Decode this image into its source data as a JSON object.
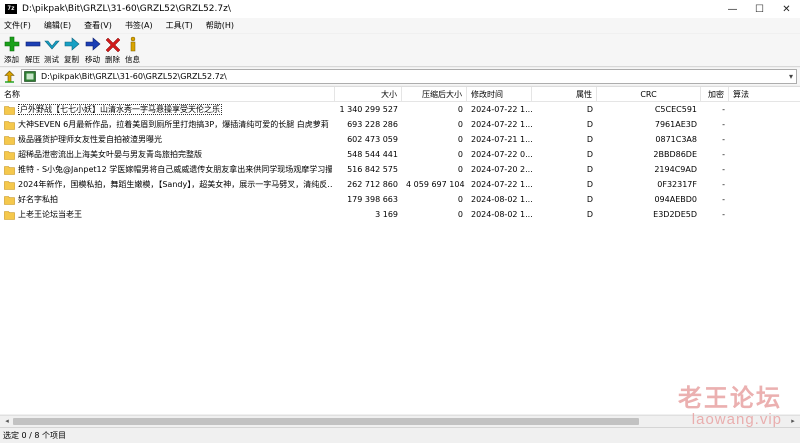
{
  "window": {
    "app_icon_text": "7z",
    "title": "D:\\pikpak\\Bit\\GRZL\\31-60\\GRZL52\\GRZL52.7z\\",
    "minimize": "—",
    "maximize": "☐",
    "close": "✕"
  },
  "menu": [
    "文件(F)",
    "编辑(E)",
    "查看(V)",
    "书签(A)",
    "工具(T)",
    "帮助(H)"
  ],
  "toolbar": [
    {
      "label": "添加",
      "icon": "add-icon",
      "color": "#1aa11a"
    },
    {
      "label": "解压",
      "icon": "extract-icon",
      "color": "#1c3fb5"
    },
    {
      "label": "测试",
      "icon": "test-icon",
      "color": "#18a0c4"
    },
    {
      "label": "复制",
      "icon": "copy-icon",
      "color": "#18a0c4"
    },
    {
      "label": "移动",
      "icon": "move-icon",
      "color": "#1c3fb5"
    },
    {
      "label": "删除",
      "icon": "delete-icon",
      "color": "#d01a1a"
    },
    {
      "label": "信息",
      "icon": "info-icon",
      "color": "#d9a400"
    }
  ],
  "address": {
    "path": "D:\\pikpak\\Bit\\GRZL\\31-60\\GRZL52\\GRZL52.7z\\",
    "dropdown": "▾"
  },
  "columns": {
    "name": "名称",
    "size": "大小",
    "packed": "压缩后大小",
    "modified": "修改时间",
    "attr": "属性",
    "crc": "CRC",
    "encrypted": "加密",
    "method": "算法"
  },
  "rows": [
    {
      "name": "户外野战【七七小妖】山清水秀一字马悬操享受天伦之乐",
      "size": "1 340 299 527",
      "packed": "0",
      "modified": "2024-07-22 1...",
      "attr": "D",
      "crc": "C5CEC591",
      "enc": "-"
    },
    {
      "name": "大神SEVEN 6月最新作品，拉着美眉到厕所里打炮搞3P，爆插清纯可爱的长腿 白虎萝莉",
      "size": "693 228 286",
      "packed": "0",
      "modified": "2024-07-22 1...",
      "attr": "D",
      "crc": "7961AE3D",
      "enc": "-"
    },
    {
      "name": "极品骚货护理师女友性爱自拍被渣男曝光",
      "size": "602 473 059",
      "packed": "0",
      "modified": "2024-07-21 1...",
      "attr": "D",
      "crc": "0871C3A8",
      "enc": "-"
    },
    {
      "name": "超稀品泄密流出上海美女叶晏与男友青岛旅拍完整版",
      "size": "548 544 441",
      "packed": "0",
      "modified": "2024-07-22 0...",
      "attr": "D",
      "crc": "2BBD86DE",
      "enc": "-"
    },
    {
      "name": "推特 - S小兔@Janpet12 学医嫁帽男将自己威威遗传女朋友拿出来供同学现场观摩学习攥…",
      "size": "516 842 575",
      "packed": "0",
      "modified": "2024-07-20 2...",
      "attr": "D",
      "crc": "2194C9AD",
      "enc": "-"
    },
    {
      "name": "2024年新作，国模私拍，舞蹈生嫩模，【Sandy】，超美女神，展示一字马劈叉，清纯反…",
      "size": "262 712 860",
      "packed": "4 059 697 104",
      "modified": "2024-07-22 1...",
      "attr": "D",
      "crc": "0F32317F",
      "enc": "-"
    },
    {
      "name": "好名字私拍",
      "size": "179 398 663",
      "packed": "0",
      "modified": "2024-08-02 1...",
      "attr": "D",
      "crc": "094AEBD0",
      "enc": "-"
    },
    {
      "name": "上老王论坛当老王",
      "size": "3 169",
      "packed": "0",
      "modified": "2024-08-02 1...",
      "attr": "D",
      "crc": "E3D2DE5D",
      "enc": "-"
    }
  ],
  "scroll": {
    "left": "◂",
    "right": "▸"
  },
  "status": "选定 0 / 8 个项目",
  "watermark": {
    "line1": "老王论坛",
    "line2": "laowang.vip"
  }
}
